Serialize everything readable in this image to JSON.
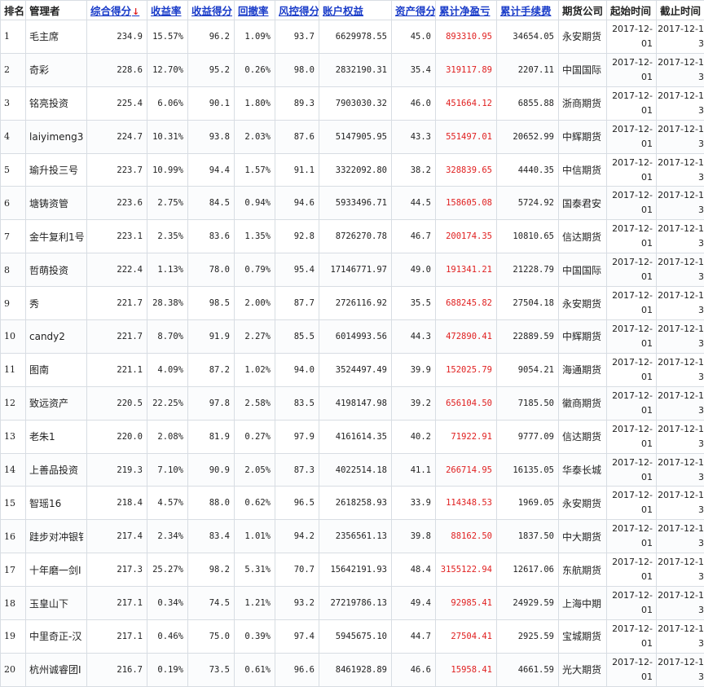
{
  "columns": [
    {
      "label": "排名",
      "sortable": false
    },
    {
      "label": "管理者",
      "sortable": false
    },
    {
      "label": "综合得分",
      "sortable": true,
      "sort_arrow": "↓"
    },
    {
      "label": "收益率",
      "sortable": true
    },
    {
      "label": "收益得分",
      "sortable": true
    },
    {
      "label": "回撤率",
      "sortable": true
    },
    {
      "label": "风控得分",
      "sortable": true
    },
    {
      "label": "账户权益",
      "sortable": true
    },
    {
      "label": "资产得分",
      "sortable": true
    },
    {
      "label": "累计净盈亏",
      "sortable": true
    },
    {
      "label": "累计手续费",
      "sortable": true
    },
    {
      "label": "期货公司",
      "sortable": false
    },
    {
      "label": "起始时间",
      "sortable": false
    },
    {
      "label": "截止时间",
      "sortable": false
    }
  ],
  "colors": {
    "link": "#1a3cc9",
    "profit": "#e02020",
    "border": "#d8dde3"
  },
  "rows": [
    {
      "rank": "1",
      "name": "毛主席",
      "score": "234.9",
      "ret": "15.57%",
      "ret_score": "96.2",
      "dd": "1.09%",
      "risk": "93.7",
      "equity": "6629978.55",
      "asset": "45.0",
      "pnl": "893310.95",
      "fee": "34654.05",
      "company": "永安期货",
      "start": "2017-12-01",
      "end": "2017-12-13"
    },
    {
      "rank": "2",
      "name": "奇彩",
      "score": "228.6",
      "ret": "12.70%",
      "ret_score": "95.2",
      "dd": "0.26%",
      "risk": "98.0",
      "equity": "2832190.31",
      "asset": "35.4",
      "pnl": "319117.89",
      "fee": "2207.11",
      "company": "中国国际",
      "start": "2017-12-01",
      "end": "2017-12-13"
    },
    {
      "rank": "3",
      "name": "铭亮投资",
      "score": "225.4",
      "ret": "6.06%",
      "ret_score": "90.1",
      "dd": "1.80%",
      "risk": "89.3",
      "equity": "7903030.32",
      "asset": "46.0",
      "pnl": "451664.12",
      "fee": "6855.88",
      "company": "浙商期货",
      "start": "2017-12-01",
      "end": "2017-12-13"
    },
    {
      "rank": "4",
      "name": "laiyimeng3",
      "score": "224.7",
      "ret": "10.31%",
      "ret_score": "93.8",
      "dd": "2.03%",
      "risk": "87.6",
      "equity": "5147905.95",
      "asset": "43.3",
      "pnl": "551497.01",
      "fee": "20652.99",
      "company": "中辉期货",
      "start": "2017-12-01",
      "end": "2017-12-13"
    },
    {
      "rank": "5",
      "name": "瑜升投三号",
      "score": "223.7",
      "ret": "10.99%",
      "ret_score": "94.4",
      "dd": "1.57%",
      "risk": "91.1",
      "equity": "3322092.80",
      "asset": "38.2",
      "pnl": "328839.65",
      "fee": "4440.35",
      "company": "中信期货",
      "start": "2017-12-01",
      "end": "2017-12-13"
    },
    {
      "rank": "6",
      "name": "塘铸资管",
      "score": "223.6",
      "ret": "2.75%",
      "ret_score": "84.5",
      "dd": "0.94%",
      "risk": "94.6",
      "equity": "5933496.71",
      "asset": "44.5",
      "pnl": "158605.08",
      "fee": "5724.92",
      "company": "国泰君安",
      "start": "2017-12-01",
      "end": "2017-12-13"
    },
    {
      "rank": "7",
      "name": "金牛复利1号",
      "score": "223.1",
      "ret": "2.35%",
      "ret_score": "83.6",
      "dd": "1.35%",
      "risk": "92.8",
      "equity": "8726270.78",
      "asset": "46.7",
      "pnl": "200174.35",
      "fee": "10810.65",
      "company": "信达期货",
      "start": "2017-12-01",
      "end": "2017-12-13"
    },
    {
      "rank": "8",
      "name": "哲萌投资",
      "score": "222.4",
      "ret": "1.13%",
      "ret_score": "78.0",
      "dd": "0.79%",
      "risk": "95.4",
      "equity": "17146771.97",
      "asset": "49.0",
      "pnl": "191341.21",
      "fee": "21228.79",
      "company": "中国国际",
      "start": "2017-12-01",
      "end": "2017-12-13"
    },
    {
      "rank": "9",
      "name": "秀",
      "score": "221.7",
      "ret": "28.38%",
      "ret_score": "98.5",
      "dd": "2.00%",
      "risk": "87.7",
      "equity": "2726116.92",
      "asset": "35.5",
      "pnl": "688245.82",
      "fee": "27504.18",
      "company": "永安期货",
      "start": "2017-12-01",
      "end": "2017-12-13"
    },
    {
      "rank": "10",
      "name": "candy2",
      "score": "221.7",
      "ret": "8.70%",
      "ret_score": "91.9",
      "dd": "2.27%",
      "risk": "85.5",
      "equity": "6014993.56",
      "asset": "44.3",
      "pnl": "472890.41",
      "fee": "22889.59",
      "company": "中辉期货",
      "start": "2017-12-01",
      "end": "2017-12-13"
    },
    {
      "rank": "11",
      "name": "图南",
      "score": "221.1",
      "ret": "4.09%",
      "ret_score": "87.2",
      "dd": "1.02%",
      "risk": "94.0",
      "equity": "3524497.49",
      "asset": "39.9",
      "pnl": "152025.79",
      "fee": "9054.21",
      "company": "海通期货",
      "start": "2017-12-01",
      "end": "2017-12-13"
    },
    {
      "rank": "12",
      "name": "致远资产",
      "score": "220.5",
      "ret": "22.25%",
      "ret_score": "97.8",
      "dd": "2.58%",
      "risk": "83.5",
      "equity": "4198147.98",
      "asset": "39.2",
      "pnl": "656104.50",
      "fee": "7185.50",
      "company": "徽商期货",
      "start": "2017-12-01",
      "end": "2017-12-13"
    },
    {
      "rank": "13",
      "name": "老朱1",
      "score": "220.0",
      "ret": "2.08%",
      "ret_score": "81.9",
      "dd": "0.27%",
      "risk": "97.9",
      "equity": "4161614.35",
      "asset": "40.2",
      "pnl": "71922.91",
      "fee": "9777.09",
      "company": "信达期货",
      "start": "2017-12-01",
      "end": "2017-12-13"
    },
    {
      "rank": "14",
      "name": "上善品投资",
      "score": "219.3",
      "ret": "7.10%",
      "ret_score": "90.9",
      "dd": "2.05%",
      "risk": "87.3",
      "equity": "4022514.18",
      "asset": "41.1",
      "pnl": "266714.95",
      "fee": "16135.05",
      "company": "华泰长城",
      "start": "2017-12-01",
      "end": "2017-12-13"
    },
    {
      "rank": "15",
      "name": "智瑶16",
      "score": "218.4",
      "ret": "4.57%",
      "ret_score": "88.0",
      "dd": "0.62%",
      "risk": "96.5",
      "equity": "2618258.93",
      "asset": "33.9",
      "pnl": "114348.53",
      "fee": "1969.05",
      "company": "永安期货",
      "start": "2017-12-01",
      "end": "2017-12-13"
    },
    {
      "rank": "16",
      "name": "跬步对冲银钅",
      "score": "217.4",
      "ret": "2.34%",
      "ret_score": "83.4",
      "dd": "1.01%",
      "risk": "94.2",
      "equity": "2356561.13",
      "asset": "39.8",
      "pnl": "88162.50",
      "fee": "1837.50",
      "company": "中大期货",
      "start": "2017-12-01",
      "end": "2017-12-13"
    },
    {
      "rank": "17",
      "name": "十年磨一剑Ⅰ",
      "score": "217.3",
      "ret": "25.27%",
      "ret_score": "98.2",
      "dd": "5.31%",
      "risk": "70.7",
      "equity": "15642191.93",
      "asset": "48.4",
      "pnl": "3155122.94",
      "fee": "12617.06",
      "company": "东航期货",
      "start": "2017-12-01",
      "end": "2017-12-13"
    },
    {
      "rank": "18",
      "name": "玉皇山下",
      "score": "217.1",
      "ret": "0.34%",
      "ret_score": "74.5",
      "dd": "1.21%",
      "risk": "93.2",
      "equity": "27219786.13",
      "asset": "49.4",
      "pnl": "92985.41",
      "fee": "24929.59",
      "company": "上海中期",
      "start": "2017-12-01",
      "end": "2017-12-13"
    },
    {
      "rank": "19",
      "name": "中里奇正-汉",
      "score": "217.1",
      "ret": "0.46%",
      "ret_score": "75.0",
      "dd": "0.39%",
      "risk": "97.4",
      "equity": "5945675.10",
      "asset": "44.7",
      "pnl": "27504.41",
      "fee": "2925.59",
      "company": "宝城期货",
      "start": "2017-12-01",
      "end": "2017-12-13"
    },
    {
      "rank": "20",
      "name": "杭州诚睿团Ⅰ",
      "score": "216.7",
      "ret": "0.19%",
      "ret_score": "73.5",
      "dd": "0.61%",
      "risk": "96.6",
      "equity": "8461928.89",
      "asset": "46.6",
      "pnl": "15958.41",
      "fee": "4661.59",
      "company": "光大期货",
      "start": "2017-12-01",
      "end": "2017-12-13"
    }
  ]
}
